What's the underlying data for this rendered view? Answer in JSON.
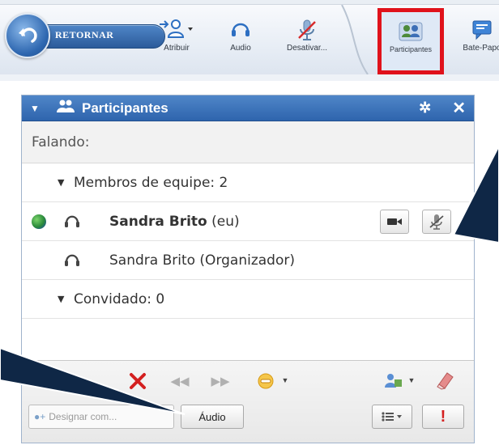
{
  "toolbar": {
    "back_label": "RETORNAR",
    "buttons": [
      {
        "label": "Atribuir",
        "icon": "assign-user-icon"
      },
      {
        "label": "Audio",
        "icon": "headset-icon"
      },
      {
        "label": "Desativar...",
        "icon": "mute-icon"
      },
      {
        "label": "Participantes",
        "icon": "participants-icon"
      },
      {
        "label": "Bate-Papo",
        "icon": "chat-icon"
      }
    ],
    "highlight_color": "#e0121b"
  },
  "panel": {
    "title": "Participantes",
    "speaking_label": "Falando:",
    "groups": [
      {
        "label": "Membros de equipe: 2"
      },
      {
        "label": "Convidado: 0"
      }
    ],
    "members": [
      {
        "name": "Sandra Brito",
        "suffix": "(eu)"
      },
      {
        "name": "Sandra Brito (Organizador)",
        "suffix": ""
      }
    ],
    "footer": {
      "input_placeholder": "Designar com...",
      "audio_button": "Áudio"
    }
  },
  "colors": {
    "header_blue": "#2e64ad",
    "accent_red": "#e0121b",
    "callout_navy": "#0f2746"
  }
}
